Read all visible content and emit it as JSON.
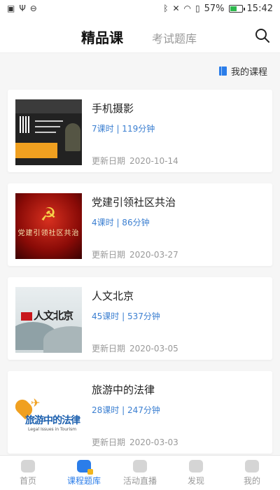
{
  "status_bar": {
    "battery": "57%",
    "time": "15:42",
    "battery_level": 0.57
  },
  "header": {
    "tab_active": "精品课",
    "tab_inactive": "考试题库"
  },
  "my_course": "我的课程",
  "date_label": "更新日期",
  "courses": [
    {
      "title": "手机摄影",
      "meta": "7课时 | 119分钟",
      "date": "2020-10-14"
    },
    {
      "title": "党建引领社区共治",
      "meta": "4课时 | 86分钟",
      "date": "2020-03-27",
      "thumb_text": "党建引领社区共治"
    },
    {
      "title": "人文北京",
      "meta": "45课时 | 537分钟",
      "date": "2020-03-05",
      "thumb_text": "人文北京"
    },
    {
      "title": "旅游中的法律",
      "meta": "28课时 | 247分钟",
      "date": "2020-03-03",
      "thumb_text": "旅游中的法律",
      "thumb_sub": "Legal Issues in Tourism"
    }
  ],
  "nav": [
    {
      "label": "首页",
      "icon": "home-icon"
    },
    {
      "label": "课程题库",
      "icon": "course-bank-icon"
    },
    {
      "label": "活动直播",
      "icon": "live-icon"
    },
    {
      "label": "发现",
      "icon": "discover-icon"
    },
    {
      "label": "我的",
      "icon": "profile-icon"
    }
  ],
  "colors": {
    "accent": "#2b7de9",
    "meta": "#3b7fd1"
  }
}
